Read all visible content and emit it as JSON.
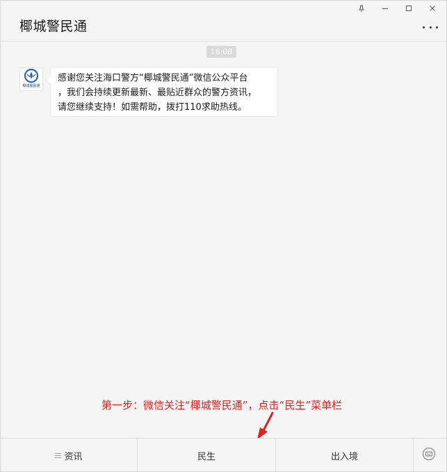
{
  "window": {
    "title": "椰城警民通"
  },
  "chat": {
    "timestamp": "16:08",
    "avatar_text": "椰城警民通",
    "message_lines": [
      "感谢您关注海口警方“椰城警民通”微信公众平台",
      "，我们会持续更新最新、最贴近群众的警方资讯，",
      "请您继续支持！如需帮助，拨打110求助热线。"
    ]
  },
  "annotation": {
    "text": "第一步：微信关注“椰城警民通”，点击“民生”菜单栏",
    "color": "#e02020"
  },
  "menu": {
    "items": [
      {
        "label": "资讯",
        "icon": "menu-list-icon"
      },
      {
        "label": "民生"
      },
      {
        "label": "出入境"
      }
    ],
    "keyboard_icon": "keyboard-icon"
  },
  "controls": {
    "icons": [
      "pin-icon",
      "minimize-icon",
      "maximize-icon",
      "close-icon",
      "more-icon"
    ]
  }
}
